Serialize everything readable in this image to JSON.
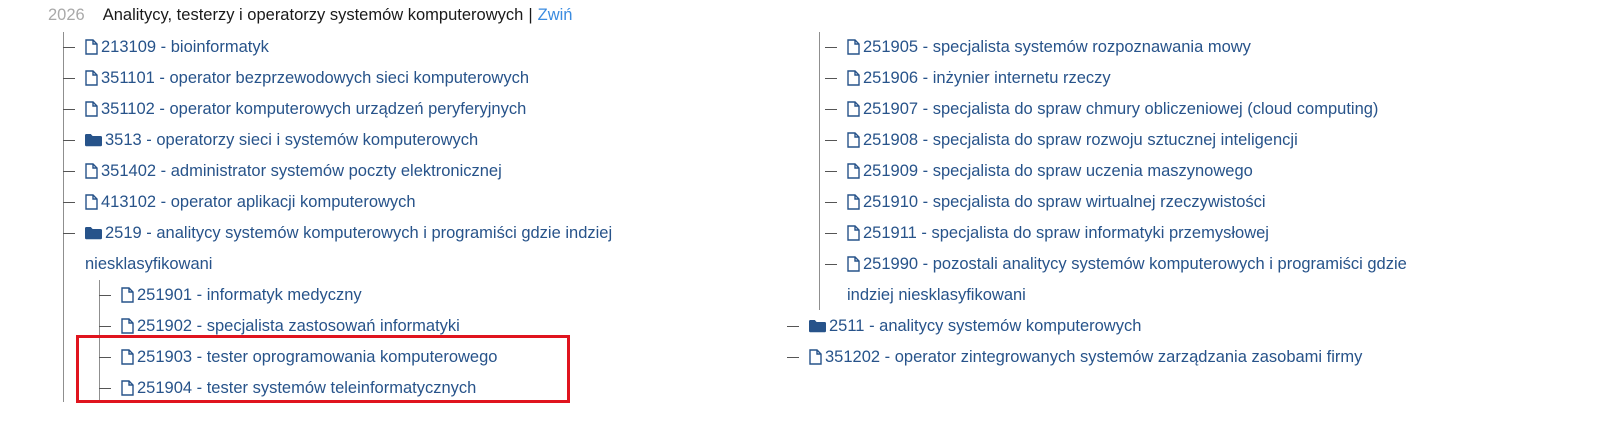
{
  "header": {
    "code": "2026",
    "title": "Analitycy, testerzy i operatorzy systemów komputerowych",
    "separator": "|",
    "collapse_label": "Zwiń"
  },
  "left_items": [
    {
      "label": "213109 - bioinformatyk",
      "icon": "file-icon"
    },
    {
      "label": "351101 - operator bezprzewodowych sieci komputerowych",
      "icon": "file-icon"
    },
    {
      "label": "351102 - operator komputerowych urządzeń peryferyjnych",
      "icon": "file-icon"
    },
    {
      "label": "3513 - operatorzy sieci i systemów komputerowych",
      "icon": "folder-icon"
    },
    {
      "label": "351402 - administrator systemów poczty elektronicznej",
      "icon": "file-icon"
    },
    {
      "label": "413102 - operator aplikacji komputerowych",
      "icon": "file-icon"
    },
    {
      "label": "2519 - analitycy systemów komputerowych i programiści gdzie indziej",
      "label_cont": "niesklasyfikowani",
      "icon": "folder-icon"
    }
  ],
  "group_2519_children": [
    {
      "label": "251901 - informatyk medyczny",
      "icon": "file-icon"
    },
    {
      "label": "251902 - specjalista zastosowań informatyki",
      "icon": "file-icon"
    },
    {
      "label": "251903 - tester oprogramowania komputerowego",
      "icon": "file-icon"
    },
    {
      "label": "251904 - tester systemów teleinformatycznych",
      "icon": "file-icon"
    },
    {
      "label": "251905 - specjalista systemów rozpoznawania mowy",
      "icon": "file-icon"
    },
    {
      "label": "251906 - inżynier internetu rzeczy",
      "icon": "file-icon"
    },
    {
      "label": "251907 - specjalista do spraw chmury obliczeniowej (cloud computing)",
      "icon": "file-icon"
    },
    {
      "label": "251908 - specjalista do spraw rozwoju sztucznej inteligencji",
      "icon": "file-icon"
    },
    {
      "label": "251909 - specjalista do spraw uczenia maszynowego",
      "icon": "file-icon"
    },
    {
      "label": "251910 - specjalista do spraw wirtualnej rzeczywistości",
      "icon": "file-icon"
    },
    {
      "label": "251911 - specjalista do spraw informatyki przemysłowej",
      "icon": "file-icon"
    },
    {
      "label": "251990 - pozostali analitycy systemów komputerowych i programiści gdzie",
      "label_cont": "indziej niesklasyfikowani",
      "icon": "file-icon"
    }
  ],
  "right_items": [
    {
      "label": "2511 - analitycy systemów komputerowych",
      "icon": "folder-icon"
    },
    {
      "label": "351202 - operator zintegrowanych systemów zarządzania zasobami firmy",
      "icon": "file-icon"
    }
  ],
  "colors": {
    "link": "#27538a",
    "accent": "#3a8be0",
    "highlight": "#e0141e"
  }
}
